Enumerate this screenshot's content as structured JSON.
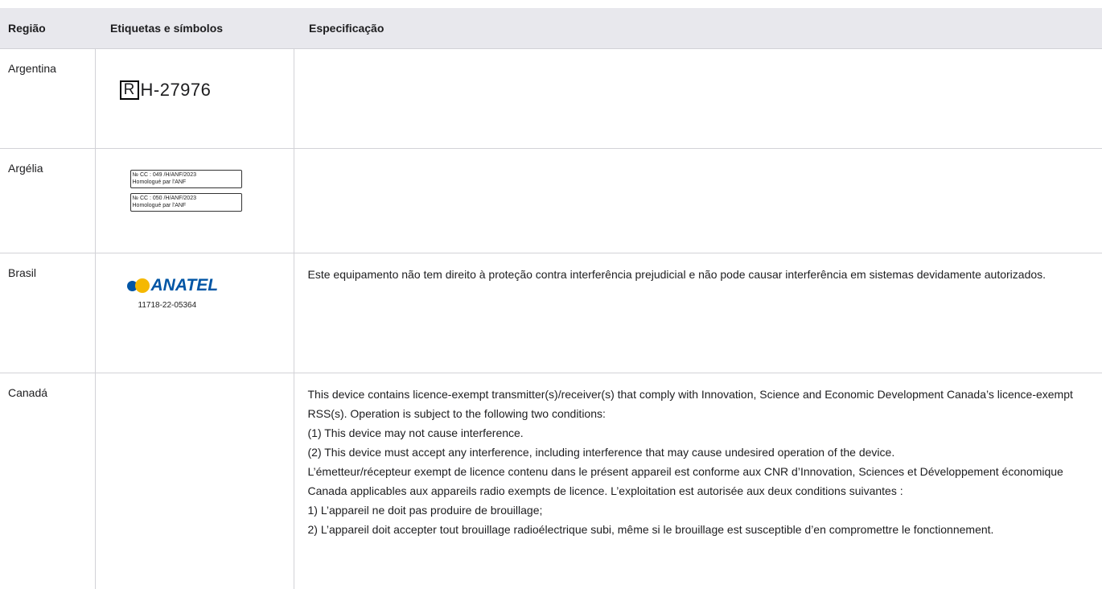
{
  "table": {
    "headers": [
      "Região",
      "Etiquetas e símbolos",
      "Especificação"
    ],
    "rows": [
      {
        "region": "Argentina",
        "label": {
          "type": "r-mark",
          "letter": "R",
          "code": "H-27976"
        },
        "spec": []
      },
      {
        "region": "Argélia",
        "label": {
          "type": "anf",
          "boxes": [
            {
              "line1": "№ CC : 049 /H/ANF/2023",
              "line2": "Homologué par l'ANF"
            },
            {
              "line1": "№ CC : 050 /H/ANF/2023",
              "line2": "Homologué par l'ANF"
            }
          ]
        },
        "spec": []
      },
      {
        "region": "Brasil",
        "label": {
          "type": "anatel",
          "brand": "ANATEL",
          "code": "11718-22-05364",
          "colors": {
            "blue": "#0055a5",
            "yellow": "#f5b800"
          }
        },
        "spec": [
          "Este equipamento não tem direito à proteção contra interferência prejudicial e não pode causar interferência em sistemas devidamente autorizados."
        ]
      },
      {
        "region": "Canadá",
        "label": null,
        "spec": [
          "This device contains licence-exempt transmitter(s)/receiver(s) that comply with Innovation, Science and Economic Development Canada’s licence-exempt RSS(s). Operation is subject to the following two conditions:",
          "(1) This device may not cause interference.",
          "(2) This device must accept any interference, including interference that may cause undesired operation of the device.",
          "L’émetteur/récepteur exempt de licence contenu dans le présent appareil est conforme aux CNR d’Innovation, Sciences et Développement économique Canada applicables aux appareils radio exempts de licence. L’exploitation est autorisée aux deux conditions suivantes :",
          "1) L’appareil ne doit pas produire de brouillage;",
          "2) L’appareil doit accepter tout brouillage radioélectrique subi, même si le brouillage est susceptible d’en compromettre le fonctionnement."
        ]
      }
    ]
  }
}
